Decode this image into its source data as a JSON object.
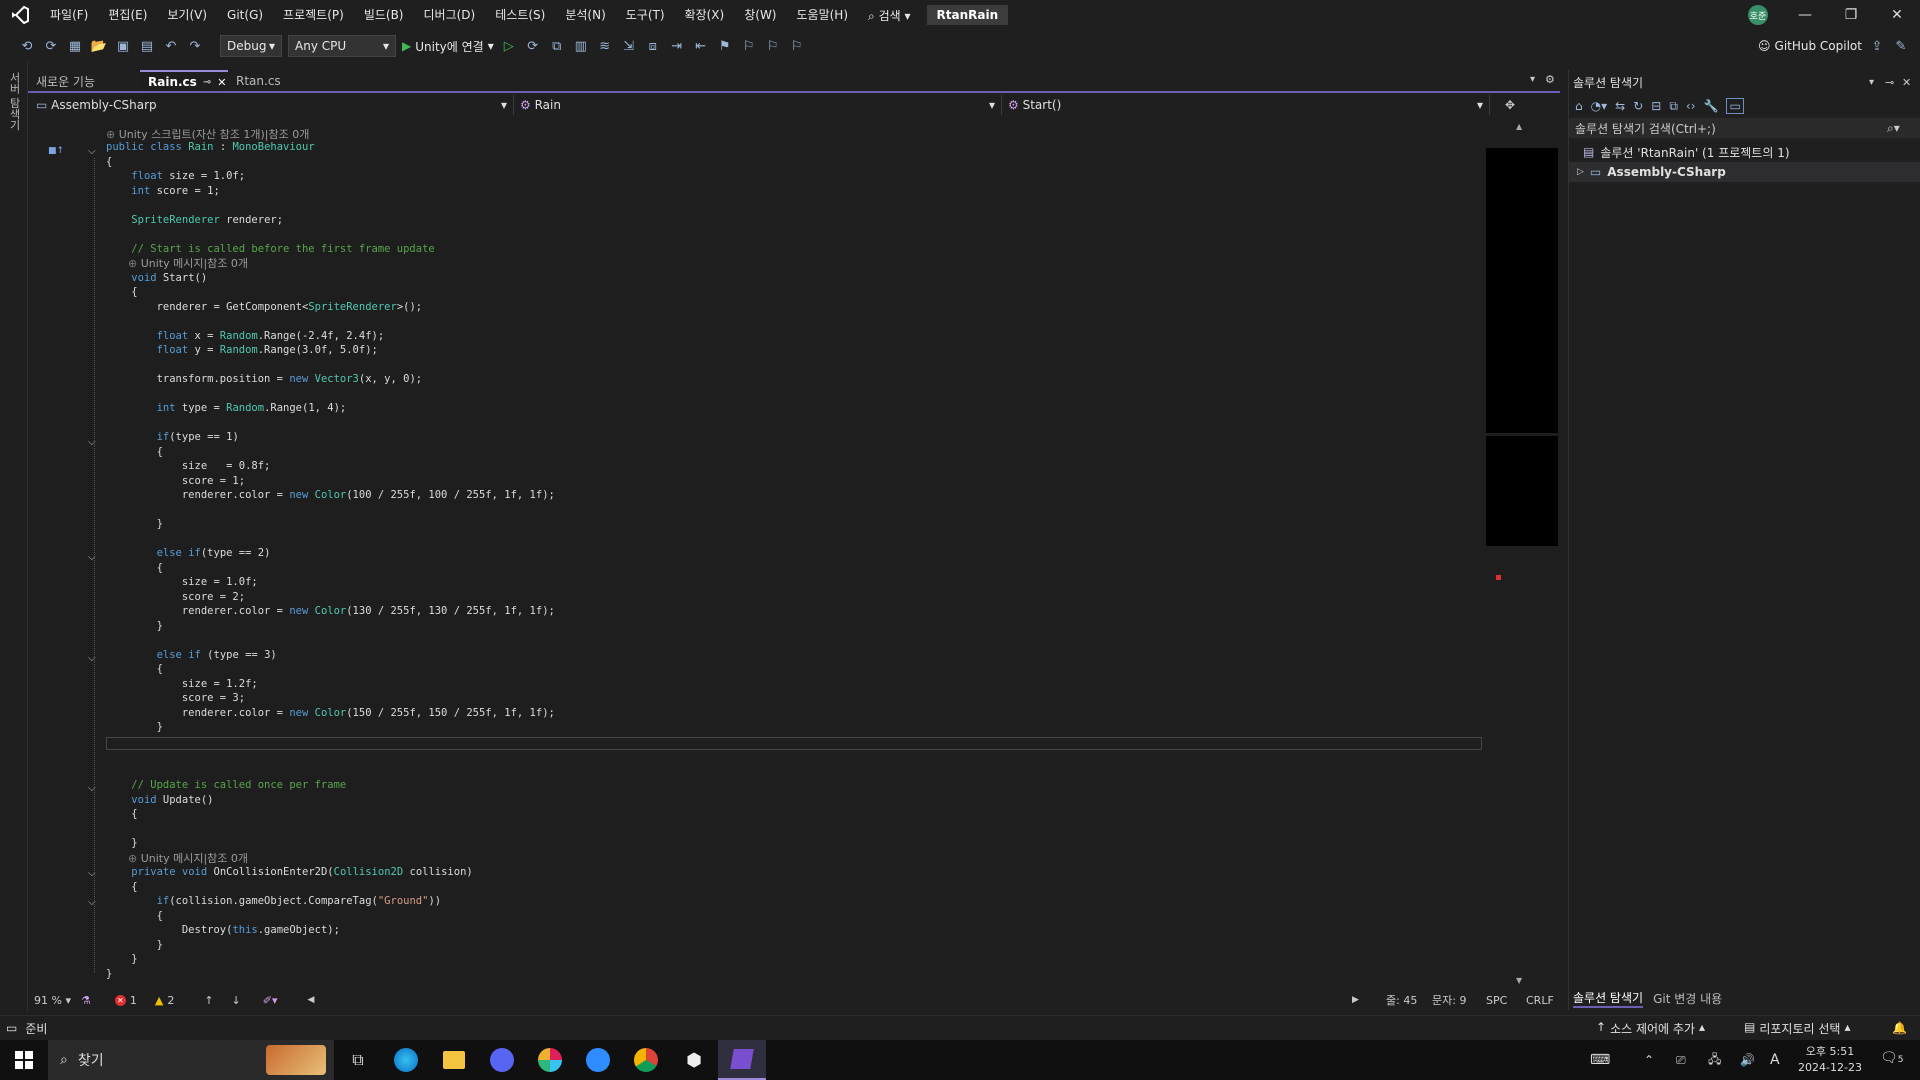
{
  "menubar": {
    "items": [
      "파일(F)",
      "편집(E)",
      "보기(V)",
      "Git(G)",
      "프로젝트(P)",
      "빌드(B)",
      "디버그(D)",
      "테스트(S)",
      "분석(N)",
      "도구(T)",
      "확장(X)",
      "창(W)",
      "도움말(H)"
    ],
    "search_label": "검색",
    "solution_name": "RtanRain",
    "avatar_text": "호준"
  },
  "toolbar": {
    "config": "Debug",
    "platform": "Any CPU",
    "run_label": "Unity에 연결",
    "copilot_label": "GitHub Copilot"
  },
  "left_strip": {
    "label": "서버 탐색기"
  },
  "tabs": [
    {
      "label": "새로운 기능",
      "active": false
    },
    {
      "label": "Rain.cs",
      "active": true
    },
    {
      "label": "Rtan.cs",
      "active": false
    }
  ],
  "navbar": {
    "project": "Assembly-CSharp",
    "class": "Rain",
    "member": "Start()"
  },
  "code": {
    "hint1": "Unity 스크립트(자산 참조 1개)|참조 0개",
    "hint2": "Unity 메시지|참조 0개",
    "hint3": "Unity 메시지|참조 0개",
    "lines": [
      "public class Rain : MonoBehaviour",
      "{",
      "    float size = 1.0f;",
      "    int score = 1;",
      "",
      "    SpriteRenderer renderer;",
      "",
      "    // Start is called before the first frame update",
      "    void Start()",
      "    {",
      "        renderer = GetComponent<SpriteRenderer>();",
      "",
      "        float x = Random.Range(-2.4f, 2.4f);",
      "        float y = Random.Range(3.0f, 5.0f);",
      "",
      "        transform.position = new Vector3(x, y, 0);",
      "",
      "        int type = Random.Range(1, 4);",
      "",
      "        if(type == 1)",
      "        {",
      "            size   = 0.8f;",
      "            score = 1;",
      "            renderer.color = new Color(100 / 255f, 100 / 255f, 1f, 1f);",
      "",
      "        }",
      "",
      "        else if(type == 2)",
      "        {",
      "            size = 1.0f;",
      "            score = 2;",
      "            renderer.color = new Color(130 / 255f, 130 / 255f, 1f, 1f);",
      "        }",
      "",
      "        else if (type == 3)",
      "        {",
      "            size = 1.2f;",
      "            score = 3;",
      "            renderer.color = new Color(150 / 255f, 150 / 255f, 1f, 1f);",
      "        }",
      "",
      "",
      "    // Update is called once per frame",
      "    void Update()",
      "    {",
      "",
      "    }",
      "    private void OnCollisionEnter2D(Collision2D collision)",
      "    {",
      "        if(collision.gameObject.CompareTag(\"Ground\"))",
      "        {",
      "            Destroy(this.gameObject);",
      "        }",
      "    }",
      "}"
    ]
  },
  "editor_status": {
    "zoom": "91 %",
    "errors": "1",
    "warnings": "2",
    "line": "줄: 45",
    "col": "문자: 9",
    "spc": "SPC",
    "eol": "CRLF"
  },
  "solution_explorer": {
    "title": "솔루션 탐색기",
    "search_placeholder": "솔루션 탐색기 검색(Ctrl+;)",
    "solution_row": "솔루션 'RtanRain' (1 프로젝트의 1)",
    "project_row": "Assembly-CSharp",
    "bottom_tab1": "솔루션 탐색기",
    "bottom_tab2": "Git 변경 내용"
  },
  "statusbar": {
    "ready": "준비",
    "source_control": "소스 제어에 추가",
    "repository": "리포지토리 선택"
  },
  "taskbar": {
    "search_label": "찾기",
    "time": "오후 5:51",
    "date": "2024-12-23",
    "lang": "A",
    "notif_count": "5"
  },
  "colors": {
    "accent": "#6b5fb5",
    "keyword": "#569cd6",
    "type": "#4ec9b0",
    "comment": "#57a64a",
    "string": "#d69d85"
  }
}
